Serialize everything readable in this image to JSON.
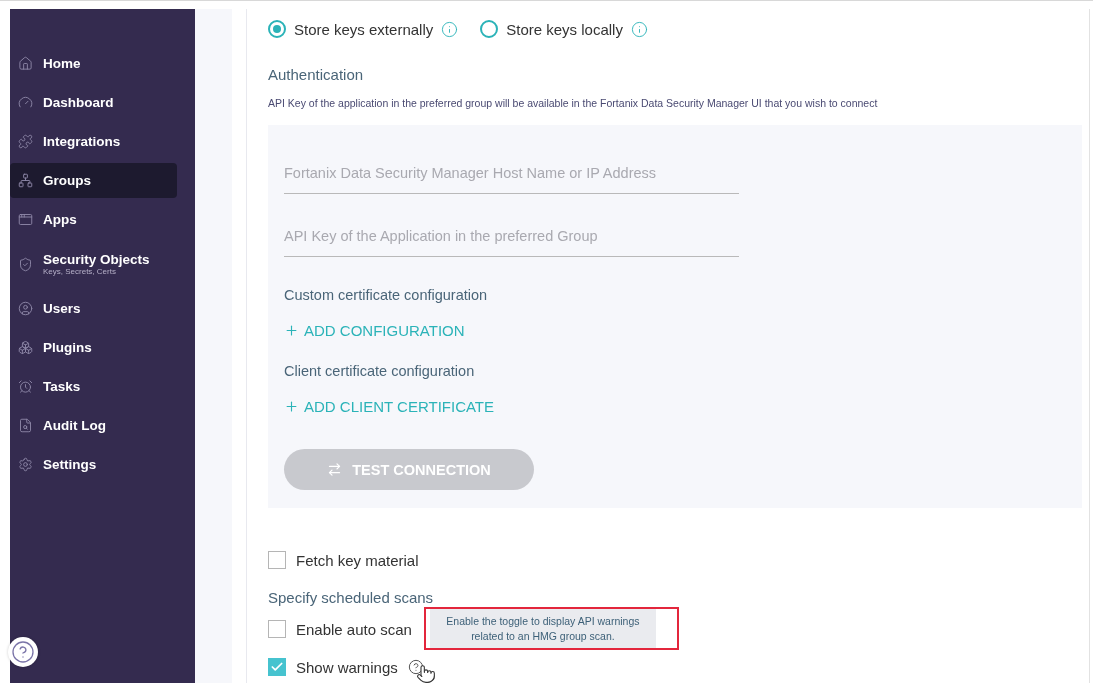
{
  "sidebar": {
    "items": [
      {
        "label": "Home",
        "selected": false
      },
      {
        "label": "Dashboard",
        "selected": false
      },
      {
        "label": "Integrations",
        "selected": false
      },
      {
        "label": "Groups",
        "selected": true
      },
      {
        "label": "Apps",
        "selected": false
      },
      {
        "label": "Security Objects",
        "sublabel": "Keys, Secrets, Certs",
        "selected": false
      },
      {
        "label": "Users",
        "selected": false
      },
      {
        "label": "Plugins",
        "selected": false
      },
      {
        "label": "Tasks",
        "selected": false
      },
      {
        "label": "Audit Log",
        "selected": false
      },
      {
        "label": "Settings",
        "selected": false
      }
    ]
  },
  "key_storage": [
    {
      "label": "Store keys externally",
      "selected": true
    },
    {
      "label": "Store keys locally",
      "selected": false
    }
  ],
  "authentication": {
    "title": "Authentication",
    "description": "API Key of the application in the preferred group will be available in the Fortanix Data Security Manager UI that you wish to connect",
    "fields": [
      {
        "placeholder": "Fortanix Data Security Manager Host Name or IP Address"
      },
      {
        "placeholder": "API Key of the Application in the preferred Group"
      }
    ],
    "sections": [
      {
        "title": "Custom certificate configuration",
        "action": "ADD CONFIGURATION"
      },
      {
        "title": "Client certificate configuration",
        "action": "ADD CLIENT CERTIFICATE"
      }
    ],
    "test_button": {
      "label": "TEST CONNECTION",
      "disabled": true
    }
  },
  "fetch_option": {
    "label": "Fetch key material",
    "checked": false
  },
  "scans_title": "Specify scheduled scans",
  "scan_options": [
    {
      "label": "Enable auto scan",
      "checked": false
    },
    {
      "label": "Show warnings",
      "checked": true
    }
  ],
  "tooltip": {
    "text": "Enable the toggle to display API warnings related to an HMG group scan."
  }
}
